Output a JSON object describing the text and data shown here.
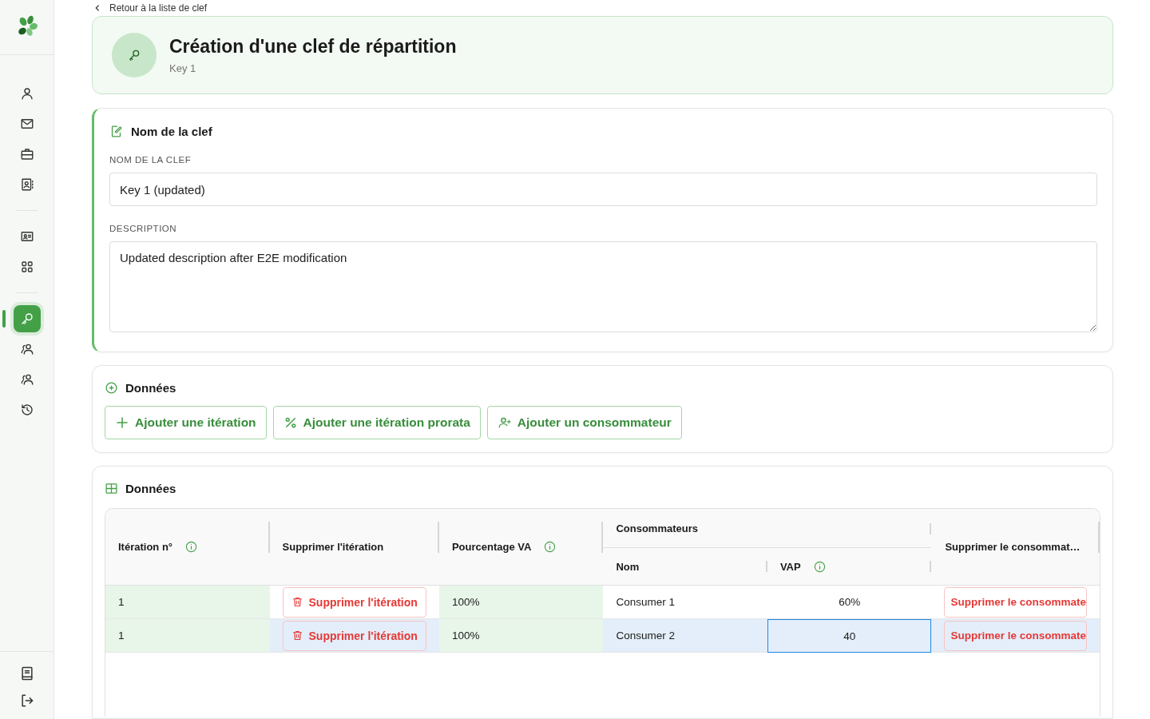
{
  "sidebar": {
    "top_groups": [
      [
        {
          "kind": "person",
          "selected": false
        },
        {
          "kind": "mail",
          "selected": false
        },
        {
          "kind": "briefcase",
          "selected": false
        },
        {
          "kind": "contacts",
          "selected": false
        }
      ],
      [
        {
          "kind": "idcard",
          "selected": false
        },
        {
          "kind": "grid",
          "selected": false
        }
      ],
      [
        {
          "kind": "key",
          "selected": true
        },
        {
          "kind": "people",
          "selected": false
        },
        {
          "kind": "people",
          "selected": false
        },
        {
          "kind": "history",
          "selected": false
        }
      ]
    ],
    "bottom": [
      {
        "kind": "book",
        "selected": false
      },
      {
        "kind": "logout",
        "selected": false
      }
    ]
  },
  "back_link": "Retour à la liste de clef",
  "header": {
    "title": "Création d'une clef de répartition",
    "subtitle": "Key 1"
  },
  "name_section": {
    "title": "Nom de la clef",
    "name_label": "NOM DE LA CLEF",
    "name_value": "Key 1 (updated)",
    "description_label": "DESCRIPTION",
    "description_value": "Updated description after E2E modification"
  },
  "actions_section": {
    "title": "Données",
    "buttons": [
      {
        "kind": "plus",
        "label": "Ajouter une itération"
      },
      {
        "kind": "percent",
        "label": "Ajouter une itération prorata"
      },
      {
        "kind": "user-plus",
        "label": "Ajouter un consommateur"
      }
    ]
  },
  "table_section": {
    "title": "Données",
    "columns": {
      "iteration": "Itération n°",
      "delete_iteration": "Supprimer l'itération",
      "percentage": "Pourcentage VA",
      "consumers": "Consommateurs",
      "name": "Nom",
      "vap": "VAP",
      "delete_consumer": "Supprimer le consommat…"
    },
    "rows": [
      {
        "iteration": "1",
        "delete_iteration": "Supprimer l'itération",
        "percentage": "100%",
        "name": "Consumer 1",
        "vap": "60%",
        "vap_editing": false,
        "delete_consumer": "Supprimer le consommate",
        "selected": false
      },
      {
        "iteration": "1",
        "delete_iteration": "Supprimer l'itération",
        "percentage": "100%",
        "name": "Consumer 2",
        "vap": "40",
        "vap_editing": true,
        "delete_consumer": "Supprimer le consommate",
        "selected": true
      }
    ]
  }
}
